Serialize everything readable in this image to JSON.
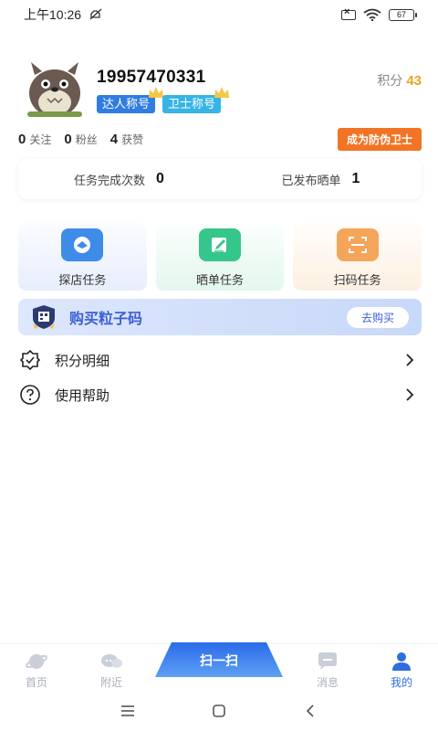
{
  "status_bar": {
    "time": "上午10:26",
    "battery_level": "67"
  },
  "profile": {
    "phone": "19957470331",
    "badges": [
      "达人称号",
      "卫士称号"
    ],
    "points_label": "积分",
    "points_value": "43"
  },
  "stats": {
    "follow_count": "0",
    "follow_label": "关注",
    "fans_count": "0",
    "fans_label": "粉丝",
    "likes_count": "4",
    "likes_label": "获赞",
    "guard_button": "成为防伪卫士"
  },
  "summary": {
    "tasks_label": "任务完成次数",
    "tasks_value": "0",
    "posts_label": "已发布晒单",
    "posts_value": "1"
  },
  "tasks": [
    {
      "label": "探店任务",
      "icon": "shop-visit-icon",
      "color": "#3f8be8"
    },
    {
      "label": "晒单任务",
      "icon": "edit-post-icon",
      "color": "#35c68b"
    },
    {
      "label": "扫码任务",
      "icon": "scan-frame-icon",
      "color": "#f4a55a"
    }
  ],
  "buy_banner": {
    "title": "购买粒子码",
    "button": "去购买"
  },
  "menu": [
    {
      "label": "积分明细",
      "icon": "points-badge-icon"
    },
    {
      "label": "使用帮助",
      "icon": "help-question-icon"
    }
  ],
  "tabbar": {
    "home": "首页",
    "nearby": "附近",
    "scan": "扫一扫",
    "messages": "消息",
    "mine": "我的"
  },
  "colors": {
    "accent": "#2f6de0",
    "orange": "#f27424",
    "points": "#f0a223"
  }
}
